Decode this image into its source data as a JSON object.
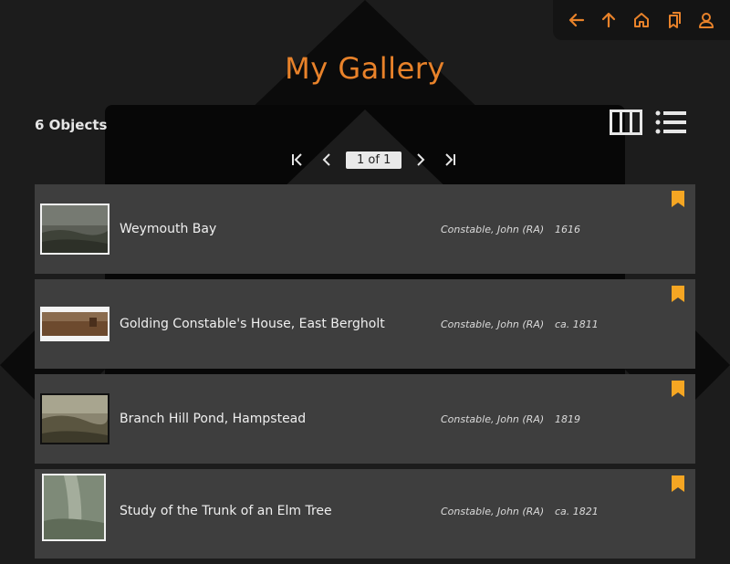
{
  "header": {
    "title": "My Gallery",
    "object_count": "6 Objects"
  },
  "toolbar": {
    "icons": [
      "back-arrow-icon",
      "up-arrow-icon",
      "home-icon",
      "bookmarks-icon",
      "user-icon"
    ],
    "accent_color": "#e8822a"
  },
  "view_options": [
    "grid-view-icon",
    "list-view-icon"
  ],
  "pager": {
    "label": "1 of 1"
  },
  "objects": [
    {
      "title": "Weymouth Bay",
      "artist": "Constable, John (RA)",
      "date": "1616"
    },
    {
      "title": "Golding Constable's House, East Bergholt",
      "artist": "Constable, John (RA)",
      "date": "ca. 1811"
    },
    {
      "title": "Branch Hill Pond, Hampstead",
      "artist": "Constable, John (RA)",
      "date": "1819"
    },
    {
      "title": "Study of the Trunk of an Elm Tree",
      "artist": "Constable, John (RA)",
      "date": "ca. 1821"
    }
  ],
  "colors": {
    "background": "#1c1c1c",
    "row": "#3e3e3e",
    "accent": "#e8822a",
    "bookmark": "#f5a623"
  }
}
